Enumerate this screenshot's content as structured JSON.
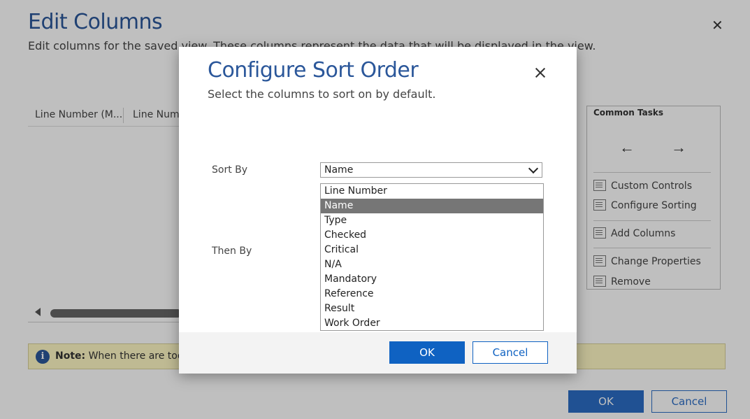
{
  "background": {
    "title": "Edit Columns",
    "subtitle": "Edit columns for the saved view. These columns represent the data that will be displayed in the view.",
    "columns": [
      "Line Number (M...",
      "Line Numb"
    ],
    "note_label": "Note:",
    "note_text": " When there are too m",
    "ok_label": "OK",
    "cancel_label": "Cancel",
    "common_tasks": {
      "title": "Common Tasks",
      "items": [
        "Custom Controls",
        "Configure Sorting",
        "Add Columns",
        "Change Properties",
        "Remove"
      ]
    }
  },
  "dialog": {
    "title": "Configure Sort Order",
    "subtitle": "Select the columns to sort on by default.",
    "sort_by_label": "Sort By",
    "then_by_label": "Then By",
    "sort_by_value": "Name",
    "options": [
      "Line Number",
      "Name",
      "Type",
      "Checked",
      "Critical",
      "N/A",
      "Mandatory",
      "Reference",
      "Result",
      "Work Order"
    ],
    "selected_option": "Name",
    "ok_label": "OK",
    "cancel_label": "Cancel"
  }
}
